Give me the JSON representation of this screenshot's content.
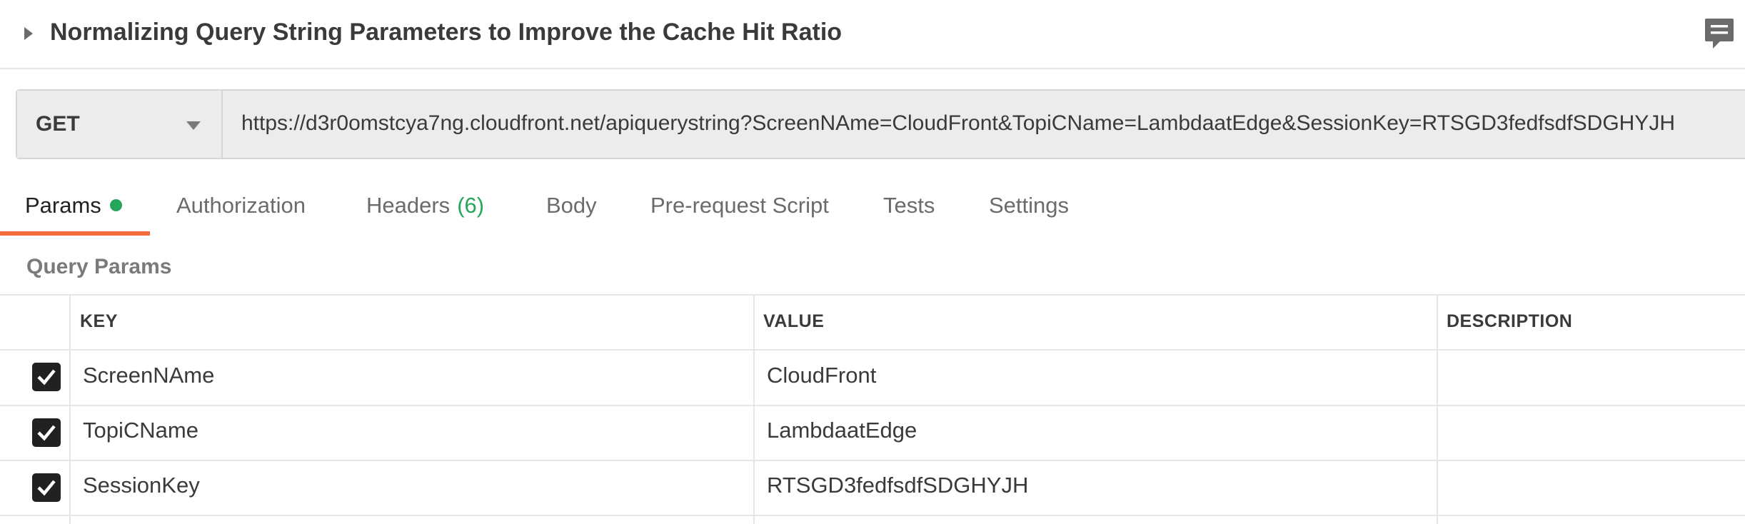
{
  "request": {
    "title": "Normalizing Query String Parameters to Improve the Cache Hit Ratio",
    "method": "GET",
    "url": "https://d3r0omstcya7ng.cloudfront.net/apiquerystring?ScreenNAme=CloudFront&TopiCName=LambdaatEdge&SessionKey=RTSGD3fedfsdfSDGHYJH"
  },
  "tabs": {
    "params": "Params",
    "authorization": "Authorization",
    "headers": "Headers",
    "headers_count": "(6)",
    "body": "Body",
    "prerequest": "Pre-request Script",
    "tests": "Tests",
    "settings": "Settings"
  },
  "query_params": {
    "label": "Query Params",
    "columns": {
      "key": "KEY",
      "value": "VALUE",
      "description": "DESCRIPTION"
    },
    "rows": [
      {
        "key": "ScreenNAme",
        "value": "CloudFront",
        "description": "",
        "checked": true
      },
      {
        "key": "TopiCName",
        "value": "LambdaatEdge",
        "description": "",
        "checked": true
      },
      {
        "key": "SessionKey",
        "value": "RTSGD3fedfsdfSDGHYJH",
        "description": "",
        "checked": true
      }
    ]
  },
  "colors": {
    "accent": "#f26b3a",
    "status_green": "#26a65b"
  },
  "icons": {
    "collapse": "caret-right-icon",
    "comments": "comments-icon",
    "method_dropdown": "chevron-down-icon",
    "checkbox": "checkmark-icon"
  }
}
